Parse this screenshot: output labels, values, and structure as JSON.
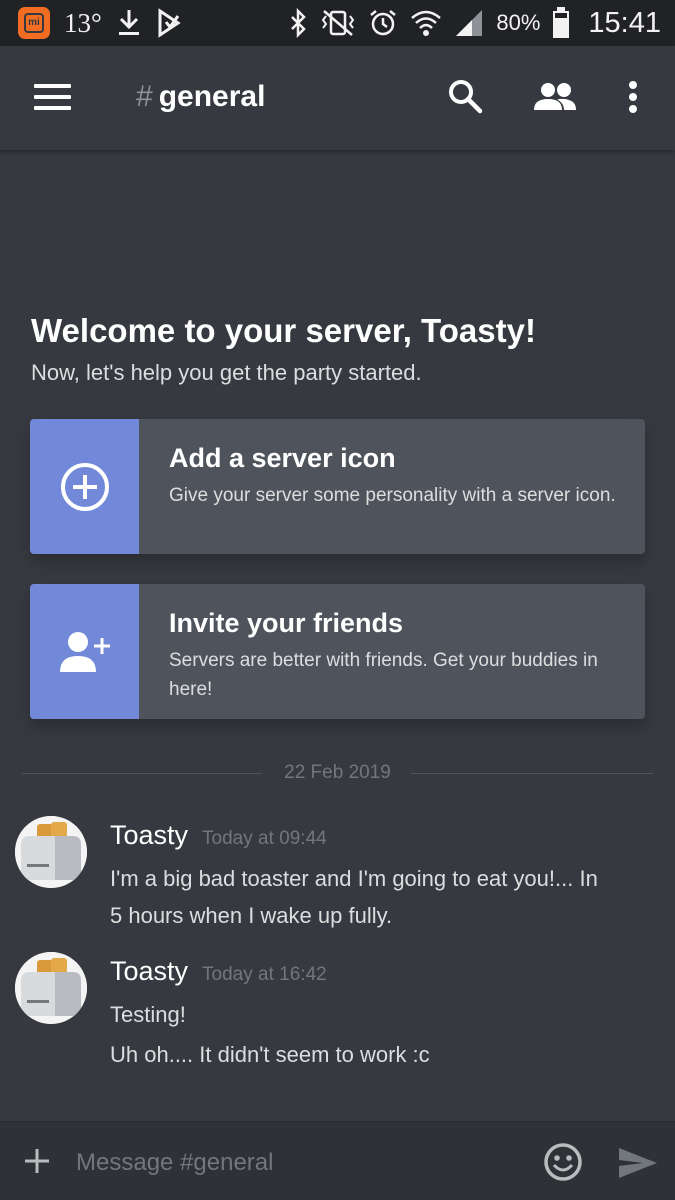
{
  "status_bar": {
    "temperature": "13°",
    "battery": "80%",
    "time": "15:41"
  },
  "header": {
    "hash": "#",
    "channel": "general"
  },
  "welcome": {
    "title": "Welcome to your server, Toasty!",
    "subtitle": "Now, let's help you get the party started."
  },
  "cards": [
    {
      "title": "Add a server icon",
      "description": "Give your server some personality with a server icon.",
      "icon": "add-circle-icon"
    },
    {
      "title": "Invite your friends",
      "description": "Servers are better with friends. Get your buddies in here!",
      "icon": "add-user-icon"
    }
  ],
  "divider": {
    "date": "22 Feb 2019"
  },
  "messages": [
    {
      "author": "Toasty",
      "timestamp": "Today at 09:44",
      "lines": [
        "I'm a big bad toaster and I'm going to eat you!... In",
        "5 hours when I wake up fully."
      ]
    },
    {
      "author": "Toasty",
      "timestamp": "Today at 16:42",
      "lines": [
        "Testing!",
        "Uh oh.... It didn't seem to work :c"
      ]
    }
  ],
  "composer": {
    "placeholder": "Message #general"
  },
  "colors": {
    "background": "#36393f",
    "statusbar": "#202225",
    "blurple": "#7289da",
    "card": "#4f545c",
    "composer": "#2f3136"
  }
}
